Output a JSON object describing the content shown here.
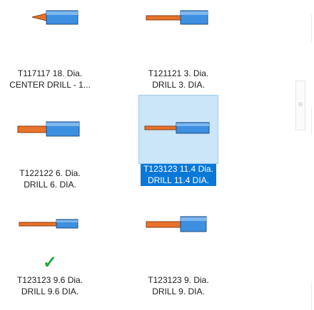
{
  "items": [
    {
      "line1": "T117117 18. Dia.",
      "line2": "CENTER DRILL - 1...",
      "selected": false,
      "checked": false
    },
    {
      "line1": "T121121 3. Dia.",
      "line2": "DRILL 3. DIA.",
      "selected": false,
      "checked": false
    },
    {
      "line1": "T122122 6. Dia.",
      "line2": "DRILL 6. DIA.",
      "selected": false,
      "checked": false
    },
    {
      "line1": "T123123 11.4 Dia.",
      "line2": "DRILL 11.4 DIA.",
      "selected": true,
      "checked": false
    },
    {
      "line1": "T123123 9.6 Dia.",
      "line2": "DRILL 9.6 DIA.",
      "selected": false,
      "checked": true
    },
    {
      "line1": "T123123 9. Dia.",
      "line2": "DRILL 9. DIA.",
      "selected": false,
      "checked": false
    }
  ],
  "check_glyph": "✓",
  "colors": {
    "tool_body": "#3d8fe0",
    "tool_shank": "#e8732a",
    "selection": "#0a78d7",
    "check": "#22a83a"
  }
}
